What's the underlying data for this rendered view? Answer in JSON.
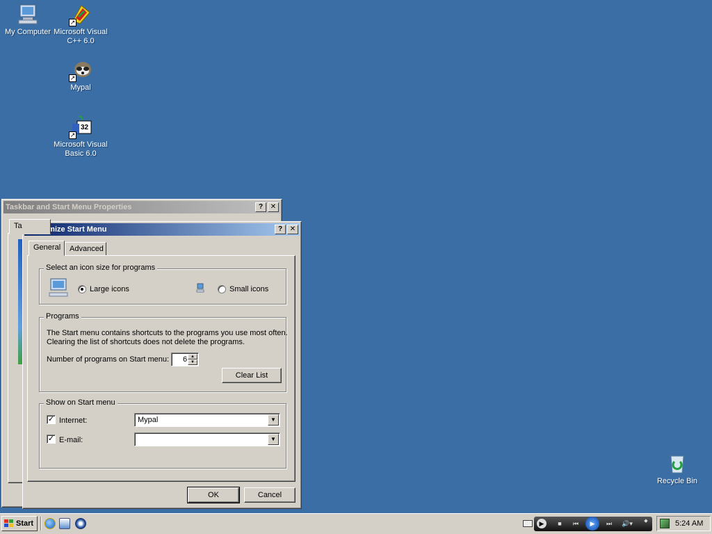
{
  "desktop": {
    "icons": [
      {
        "label": "My Computer",
        "icon": "computer-icon"
      },
      {
        "label": "Microsoft Visual C++ 6.0",
        "icon": "visual-cpp-icon"
      },
      {
        "label": "Mypal",
        "icon": "mypal-raccoon-icon"
      },
      {
        "label": "Microsoft Visual Basic 6.0",
        "icon": "visual-basic-icon"
      },
      {
        "label": "Recycle Bin",
        "icon": "recycle-bin-icon"
      }
    ],
    "shortcut_badge": "↗",
    "vb_badge": "32"
  },
  "back_window": {
    "title": "Taskbar and Start Menu Properties",
    "tab_partial": "Ta",
    "help_label": "?",
    "close_label": "✕"
  },
  "dialog": {
    "title": "Customize Start Menu",
    "help_label": "?",
    "close_label": "✕",
    "tabs": [
      {
        "label": "General",
        "selected": true
      },
      {
        "label": "Advanced",
        "selected": false
      }
    ],
    "icon_size": {
      "group_title": "Select an icon size for programs",
      "large_label": "Large icons",
      "small_label": "Small icons",
      "selected": "large"
    },
    "programs": {
      "group_title": "Programs",
      "description_line1": "The Start menu contains shortcuts to the programs you use most often.",
      "description_line2": "Clearing the list of shortcuts does not delete the programs.",
      "count_label": "Number of programs on Start menu:",
      "count_value": "6",
      "clear_button": "Clear List"
    },
    "show_on_start": {
      "group_title": "Show on Start menu",
      "internet_label": "Internet:",
      "internet_checked": true,
      "internet_value": "Mypal",
      "email_label": "E-mail:",
      "email_checked": true,
      "email_value": ""
    },
    "ok_button": "OK",
    "cancel_button": "Cancel"
  },
  "taskbar": {
    "start_label": "Start",
    "quick_launch": [
      "internet-explorer-icon",
      "show-desktop-icon",
      "media-player-icon"
    ],
    "clock": "5:24 AM"
  },
  "colors": {
    "desktop": "#3a6ea5",
    "title_active": "#0a246a",
    "face": "#d4d0c8"
  }
}
